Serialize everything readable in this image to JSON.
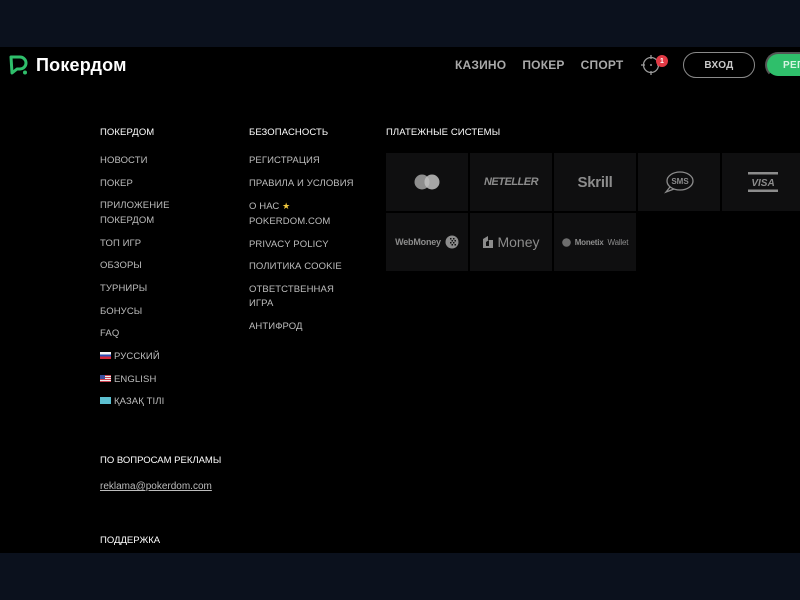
{
  "header": {
    "logo_text": "Покердом",
    "nav": [
      "КАЗИНО",
      "ПОКЕР",
      "СПОРТ"
    ],
    "bonus_badge_count": "1",
    "login_label": "ВХОД",
    "register_label": "РЕГИСТРАЦИЯ",
    "brand_color": "#2fbf6b",
    "badge_color": "#e23a45"
  },
  "footer": {
    "col1": {
      "title": "ПОКЕРДОМ",
      "links": [
        "НОВОСТИ",
        "ПОКЕР",
        "ПРИЛОЖЕНИЕ ПОКЕРДОМ",
        "ТОП ИГР",
        "ОБЗОРЫ",
        "ТУРНИРЫ",
        "БОНУСЫ",
        "FAQ"
      ],
      "languages": [
        {
          "label": "РУССКИЙ",
          "flag": "ru-flag"
        },
        {
          "label": "ENGLISH",
          "flag": "us-flag"
        },
        {
          "label": "ҚАЗАҚ ТІЛІ",
          "flag": "kz-flag"
        }
      ]
    },
    "col2": {
      "title": "БЕЗОПАСНОСТЬ",
      "links": [
        "РЕГИСТРАЦИЯ",
        "ПРАВИЛА И УСЛОВИЯ",
        "О НАС",
        "POKERDOM.COM",
        "PRIVACY POLICY",
        "ПОЛИТИКА COOKIE",
        "ОТВЕТСТВЕННАЯ ИГРА",
        "АНТИФРОД"
      ],
      "about_star": "★"
    },
    "payments": {
      "title": "ПЛАТЕЖНЫЕ СИСТЕМЫ",
      "items": [
        {
          "name": "Mastercard",
          "icon": "mastercard-icon"
        },
        {
          "name": "NETELLER",
          "label": "NETELLER"
        },
        {
          "name": "Skrill",
          "label": "Skrill"
        },
        {
          "name": "SMS",
          "label": "SMS"
        },
        {
          "name": "VISA",
          "label": "VISA"
        },
        {
          "name": "WebMoney",
          "label": "WebMoney"
        },
        {
          "name": "YooMoney",
          "label": "Money"
        },
        {
          "name": "Monetix Wallet",
          "label_bold": "Monetix",
          "label_light": "Wallet"
        }
      ]
    },
    "ads": {
      "title": "ПО ВОПРОСАМ РЕКЛАМЫ",
      "email": "reklama@pokerdom.com"
    },
    "support": {
      "title": "ПОДДЕРЖКА"
    }
  }
}
